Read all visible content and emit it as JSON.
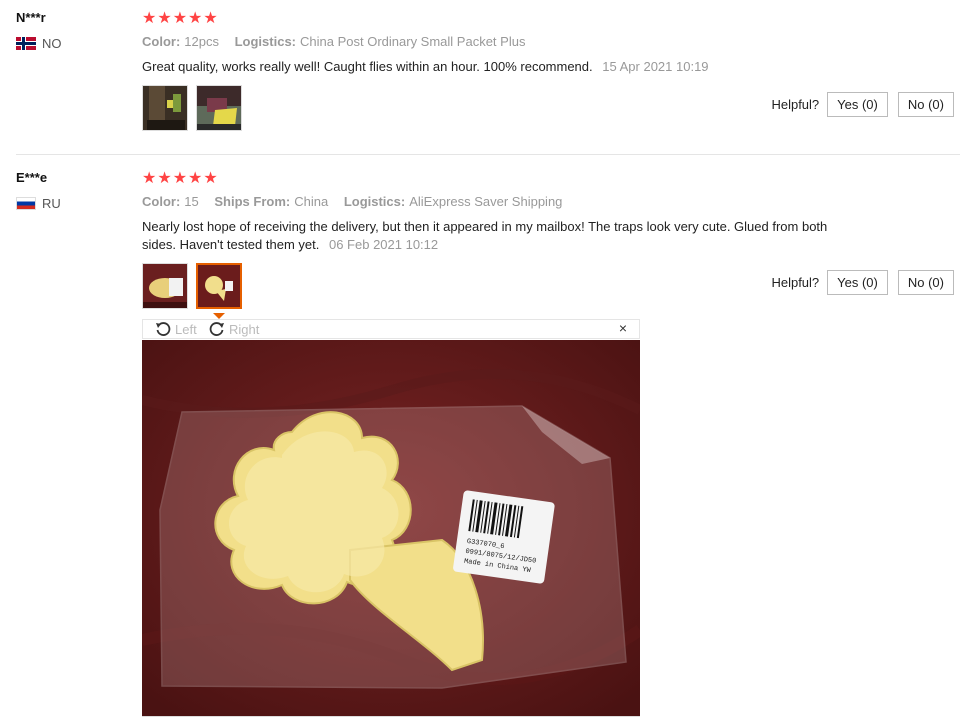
{
  "reviews": [
    {
      "user": "N***r",
      "country": "NO",
      "stars": "★★★★★",
      "rating": 5,
      "meta": [
        {
          "key": "Color:",
          "value": "12pcs"
        },
        {
          "key": "Logistics:",
          "value": "China Post Ordinary Small Packet Plus"
        }
      ],
      "text": "Great quality, works really well! Caught flies within an hour. 100% recommend.",
      "date": "15 Apr 2021 10:19",
      "helpful_label": "Helpful?",
      "yes_label": "Yes (0)",
      "no_label": "No (0)"
    },
    {
      "user": "E***e",
      "country": "RU",
      "stars": "★★★★★",
      "rating": 5,
      "meta": [
        {
          "key": "Color:",
          "value": "15"
        },
        {
          "key": "Ships From:",
          "value": "China"
        },
        {
          "key": "Logistics:",
          "value": "AliExpress Saver Shipping"
        }
      ],
      "text": "Nearly lost hope of receiving the delivery, but then it appeared in my mailbox! The traps look very cute. Glued from both sides. Haven't tested them yet.",
      "date": "06 Feb 2021 10:12",
      "helpful_label": "Helpful?",
      "yes_label": "Yes (0)",
      "no_label": "No (0)"
    }
  ],
  "viewer": {
    "left_label": "Left",
    "right_label": "Right",
    "close_label": "×",
    "label_lines": [
      "G337070_6",
      "0991/8075/12/JD50",
      "Made in China YW"
    ]
  },
  "colors": {
    "star": "#ff4747",
    "accent": "#e66000",
    "muted": "#999999"
  }
}
